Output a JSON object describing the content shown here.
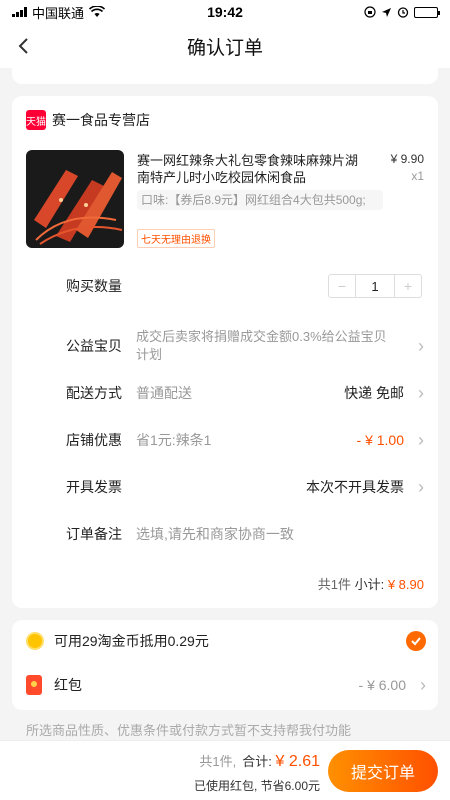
{
  "status_bar": {
    "carrier": "中国联通",
    "time": "19:42"
  },
  "nav": {
    "title": "确认订单"
  },
  "shop": {
    "badge": "天猫",
    "name": "赛一食品专营店"
  },
  "product": {
    "title": "赛一网红辣条大礼包零食辣味麻辣片湖南特产儿时小吃校园休闲食品",
    "price": "¥ 9.90",
    "qty": "x1",
    "sku": "口味:【券后8.9元】网红组合4大包共500g;",
    "return_tag": "七天无理由退换"
  },
  "rows": {
    "quantity": {
      "label": "购买数量",
      "value": "1",
      "minus": "−",
      "plus": "+"
    },
    "donation": {
      "label": "公益宝贝",
      "text": "成交后卖家将捐赠成交金额0.3%给公益宝贝计划"
    },
    "delivery": {
      "label": "配送方式",
      "sub": "普通配送",
      "value": "快递 免邮"
    },
    "discount": {
      "label": "店铺优惠",
      "sub": "省1元:辣条1",
      "value": "- ¥ 1.00"
    },
    "invoice": {
      "label": "开具发票",
      "value": "本次不开具发票"
    },
    "remark": {
      "label": "订单备注",
      "placeholder": "选填,请先和商家协商一致"
    }
  },
  "subtotal": {
    "count": "共1件",
    "label": "小计:",
    "value": "¥ 8.90"
  },
  "coins": {
    "text": "可用29淘金币抵用0.29元"
  },
  "redpack": {
    "label": "红包",
    "amount": "- ¥ 6.00"
  },
  "notice": "所选商品性质、优惠条件或付款方式暂不支持帮我付功能",
  "bottom": {
    "count": "共1件,",
    "total_label": "合计:",
    "total": "¥ 2.61",
    "saved": "已使用红包, 节省6.00元",
    "submit": "提交订单"
  },
  "colors": {
    "accent": "#ff5000",
    "button_start": "#ff9000",
    "tmall": "#ff0036"
  }
}
